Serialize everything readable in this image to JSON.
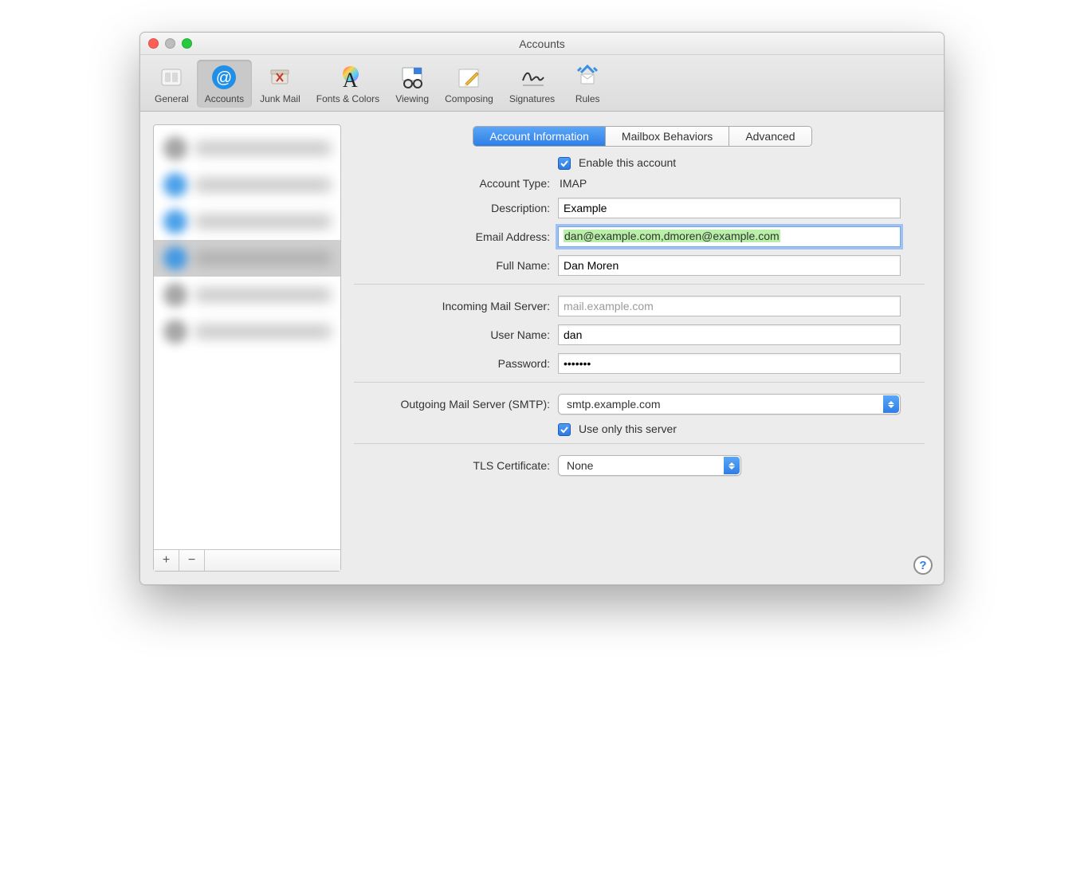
{
  "window": {
    "title": "Accounts"
  },
  "toolbar": {
    "items": [
      {
        "label": "General"
      },
      {
        "label": "Accounts"
      },
      {
        "label": "Junk Mail"
      },
      {
        "label": "Fonts & Colors"
      },
      {
        "label": "Viewing"
      },
      {
        "label": "Composing"
      },
      {
        "label": "Signatures"
      },
      {
        "label": "Rules"
      }
    ],
    "selected": "Accounts"
  },
  "tabs": {
    "items": [
      "Account Information",
      "Mailbox Behaviors",
      "Advanced"
    ],
    "active": "Account Information"
  },
  "form": {
    "enable_label": "Enable this account",
    "enable_checked": true,
    "account_type_label": "Account Type:",
    "account_type_value": "IMAP",
    "description_label": "Description:",
    "description_value": "Example",
    "email_label": "Email Address:",
    "email_value": "dan@example.com,dmoren@example.com",
    "fullname_label": "Full Name:",
    "fullname_value": "Dan Moren",
    "incoming_label": "Incoming Mail Server:",
    "incoming_value": "mail.example.com",
    "username_label": "User Name:",
    "username_value": "dan",
    "password_label": "Password:",
    "password_value": "•••••••",
    "outgoing_label": "Outgoing Mail Server (SMTP):",
    "outgoing_value": "smtp.example.com",
    "use_only_label": "Use only this server",
    "use_only_checked": true,
    "tls_label": "TLS Certificate:",
    "tls_value": "None"
  },
  "sidebar": {
    "add_symbol": "+",
    "remove_symbol": "−"
  },
  "help_symbol": "?"
}
